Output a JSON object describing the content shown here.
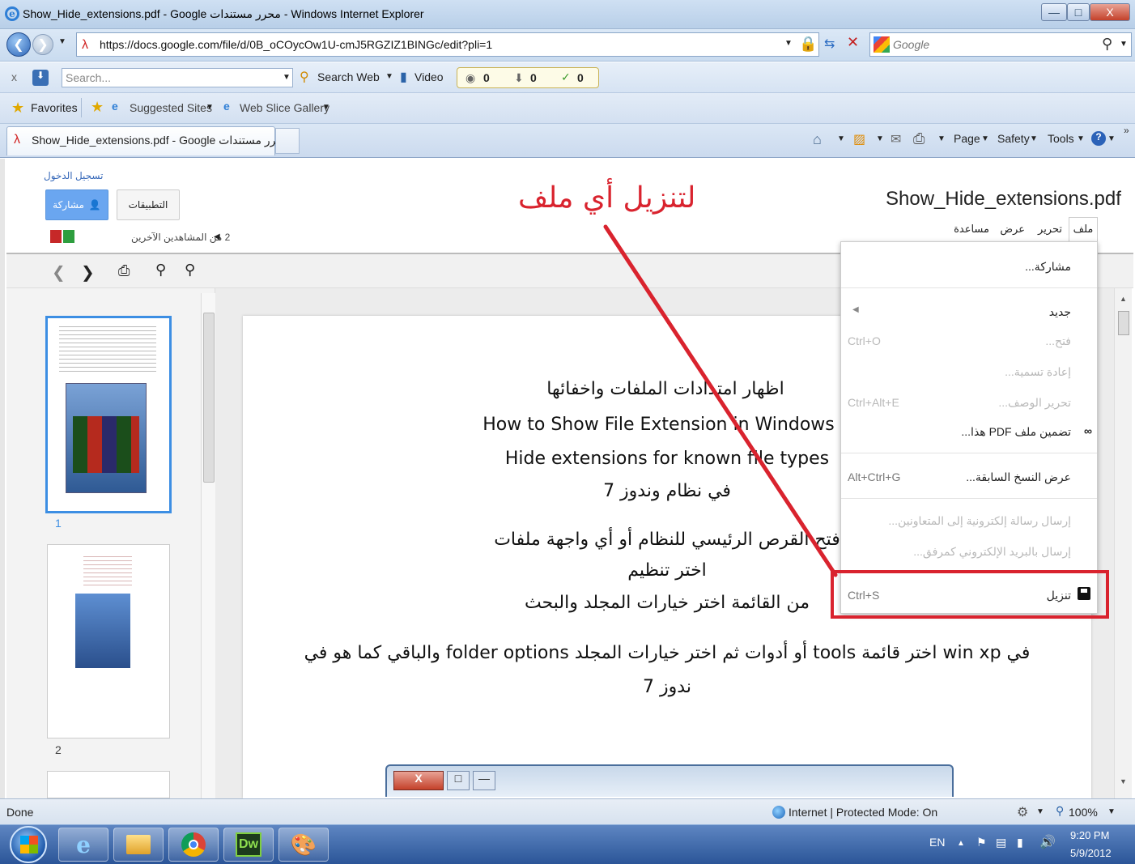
{
  "window": {
    "title": "Show_Hide_extensions.pdf - Google محرر مستندات - Windows Internet Explorer"
  },
  "address": {
    "url": "https://docs.google.com/file/d/0B_oCOycOw1U-cmJ5RGZIZ1BINGc/edit?pli=1",
    "search_engine": "Google"
  },
  "toolbar": {
    "close": "x",
    "search_placeholder": "Search...",
    "search_web": "Search Web",
    "video": "Video",
    "count1": "0",
    "count2": "0",
    "count3": "0"
  },
  "favorites": {
    "label": "Favorites",
    "suggested": "Suggested Sites",
    "webslice": "Web Slice Gallery"
  },
  "tab": {
    "title": "Show_Hide_extensions.pdf - Google محرر مستندات"
  },
  "commandbar": {
    "page": "Page",
    "safety": "Safety",
    "tools": "Tools"
  },
  "docs": {
    "signin": "تسجيل الدخول",
    "share_button": "مشاركة",
    "apps_button": "التطبيقات",
    "viewers": "2 من المشاهدين الآخرين",
    "filename": "Show_Hide_extensions.pdf",
    "menus": [
      "ملف",
      "تحرير",
      "عرض",
      "مساعدة"
    ],
    "annotation": "لتنزيل أي ملف"
  },
  "file_menu": {
    "share": "مشاركة...",
    "new": "جديد",
    "open": "فتح...",
    "open_sc": "Ctrl+O",
    "rename": "إعادة تسمية...",
    "edit_desc": "تحرير الوصف...",
    "edit_desc_sc": "Ctrl+Alt+E",
    "embed": "تضمين ملف PDF هذا...",
    "revisions": "عرض النسخ السابقة...",
    "revisions_sc": "Alt+Ctrl+G",
    "email_collab": "إرسال رسالة إلكترونية إلى المتعاونين...",
    "email_attach": "إرسال بالبريد الإلكتروني كمرفق...",
    "download": "تنزيل",
    "download_sc": "Ctrl+S"
  },
  "thumbs": {
    "p1": "1",
    "p2": "2"
  },
  "document": {
    "l1": "اظهار امتدادات الملفات واخفائها",
    "l2": "How to Show File Extension in Windows 7",
    "l3": "Hide extensions for known file types",
    "l4": "في نظام وندوز 7",
    "l5": "فتح القرص الرئيسي للنظام أو أي واجهة ملفات",
    "l6": "اختر تنظيم",
    "l7": "من القائمة اختر خيارات المجلد والبحث",
    "l8": "في win xp اختر قائمة tools أو أدوات ثم اختر خيارات المجلد folder options والباقي كما هو في",
    "l9": "ندوز 7"
  },
  "status": {
    "left": "Done",
    "zone": "Internet | Protected Mode: On",
    "zoom": "100%"
  },
  "taskbar": {
    "lang": "EN",
    "time": "9:20 PM",
    "date": "5/9/2012",
    "dw": "Dw"
  },
  "colors": {
    "annotation_red": "#d9232e",
    "share_blue": "#6aa6f0",
    "titlebar": "#c4d7ee"
  }
}
